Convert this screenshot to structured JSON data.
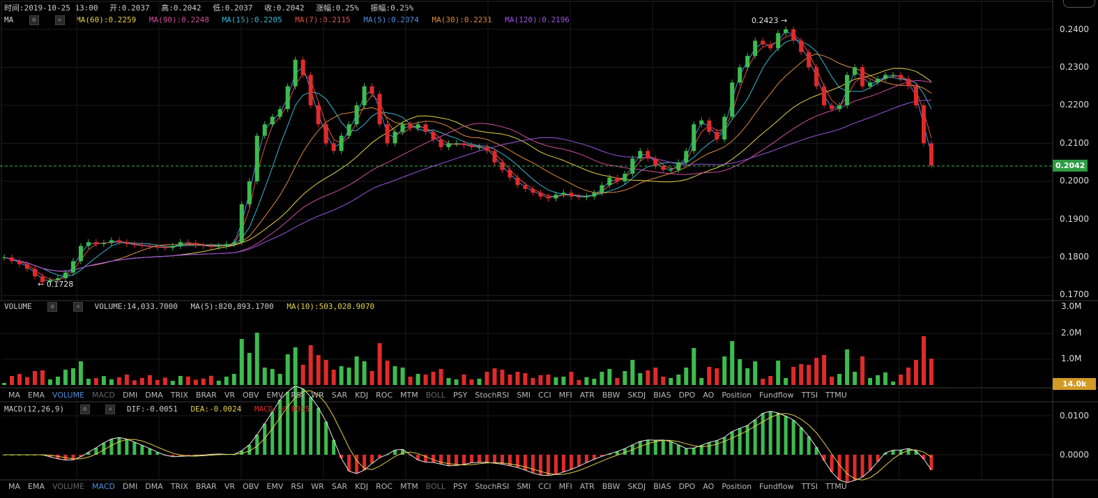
{
  "header": {
    "time": "时间:2019-10-25 13:00",
    "open": "开:0.2037",
    "high": "高:0.2042",
    "low": "低:0.2037",
    "close": "收:0.2042",
    "change": "涨幅:0.25%",
    "amplitude": "振幅:0.25%"
  },
  "ma_legend": {
    "label": "MA",
    "items": [
      {
        "text": "MA(60):0.2259",
        "color": "#e6d24a"
      },
      {
        "text": "MA(90):0.2248",
        "color": "#d24fa0"
      },
      {
        "text": "MA(15):0.2205",
        "color": "#39b9d8"
      },
      {
        "text": "MA(7):0.2115",
        "color": "#e0524a"
      },
      {
        "text": "MA(5):0.2074",
        "color": "#4f8fe0"
      },
      {
        "text": "MA(30):0.2231",
        "color": "#e08a3c"
      },
      {
        "text": "MA(120):0.2196",
        "color": "#9b55e0"
      }
    ]
  },
  "volume_legend": {
    "label": "VOLUME",
    "volume": "VOLUME:14,033.7000",
    "ma5": "MA(5):820,893.1700",
    "ma10": "MA(10):503,028.9070"
  },
  "macd_legend": {
    "label": "MACD(12,26,9)",
    "dif": "DIF:-0.0051",
    "dea": "DEA:-0.0024",
    "macd": "MACD:-0.0055"
  },
  "indicator_tabs": [
    "MA",
    "EMA",
    "VOLUME",
    "MACD",
    "DMI",
    "DMA",
    "TRIX",
    "BRAR",
    "VR",
    "OBV",
    "EMV",
    "RSI",
    "WR",
    "SAR",
    "KDJ",
    "ROC",
    "MTM",
    "BOLL",
    "PSY",
    "StochRSI",
    "SMI",
    "CCI",
    "MFI",
    "ATR",
    "BBW",
    "SKDJ",
    "BIAS",
    "DPO",
    "AO",
    "Position",
    "Fundflow",
    "TTSI",
    "TTMU"
  ],
  "price_badge": "0.2042",
  "volume_badge": "14.0k",
  "colors": {
    "up": "#3dbb4f",
    "down": "#e02a2a",
    "badge_price": "#2e9b44",
    "badge_volume": "#d29a26"
  },
  "chart_data": [
    {
      "type": "candlestick",
      "title": "",
      "ylim": [
        0.17,
        0.242
      ],
      "y_ticks": [
        "0.2400",
        "0.2300",
        "0.2200",
        "0.2100",
        "0.2000",
        "0.1900",
        "0.1800",
        "0.1700"
      ],
      "annotations": {
        "high": "0.2423 →",
        "low": "← 0.1728"
      },
      "last_price": 0.2042,
      "close_series": [
        0.18,
        0.179,
        0.1782,
        0.177,
        0.175,
        0.1735,
        0.174,
        0.1745,
        0.176,
        0.179,
        0.183,
        0.184,
        0.1835,
        0.1838,
        0.1845,
        0.184,
        0.1835,
        0.1832,
        0.183,
        0.1828,
        0.1826,
        0.1825,
        0.183,
        0.184,
        0.1838,
        0.1832,
        0.183,
        0.1828,
        0.183,
        0.1835,
        0.184,
        0.194,
        0.2,
        0.212,
        0.215,
        0.217,
        0.219,
        0.225,
        0.232,
        0.228,
        0.22,
        0.215,
        0.21,
        0.208,
        0.212,
        0.215,
        0.22,
        0.225,
        0.223,
        0.215,
        0.21,
        0.213,
        0.215,
        0.214,
        0.215,
        0.213,
        0.211,
        0.209,
        0.21,
        0.21,
        0.2095,
        0.209,
        0.209,
        0.208,
        0.205,
        0.203,
        0.201,
        0.199,
        0.198,
        0.197,
        0.196,
        0.1955,
        0.1965,
        0.197,
        0.196,
        0.1958,
        0.196,
        0.197,
        0.199,
        0.201,
        0.2,
        0.202,
        0.206,
        0.208,
        0.206,
        0.204,
        0.203,
        0.203,
        0.205,
        0.208,
        0.215,
        0.216,
        0.213,
        0.211,
        0.217,
        0.226,
        0.23,
        0.233,
        0.237,
        0.236,
        0.235,
        0.239,
        0.24,
        0.237,
        0.234,
        0.23,
        0.225,
        0.22,
        0.219,
        0.22,
        0.228,
        0.23,
        0.225,
        0.226,
        0.227,
        0.228,
        0.228,
        0.227,
        0.225,
        0.22,
        0.21,
        0.2042
      ],
      "ma_series_names": [
        "MA(60)",
        "MA(90)",
        "MA(15)",
        "MA(7)",
        "MA(5)",
        "MA(30)",
        "MA(120)"
      ]
    },
    {
      "type": "bar",
      "title": "",
      "ylim": [
        0,
        3000000
      ],
      "y_ticks": [
        "3.0M",
        "2.0M",
        "1.0M"
      ]
    },
    {
      "type": "bar",
      "title": "",
      "ylim": [
        -0.0085,
        0.0115
      ],
      "y_ticks": [
        "0.0100",
        "0.0000"
      ]
    }
  ]
}
